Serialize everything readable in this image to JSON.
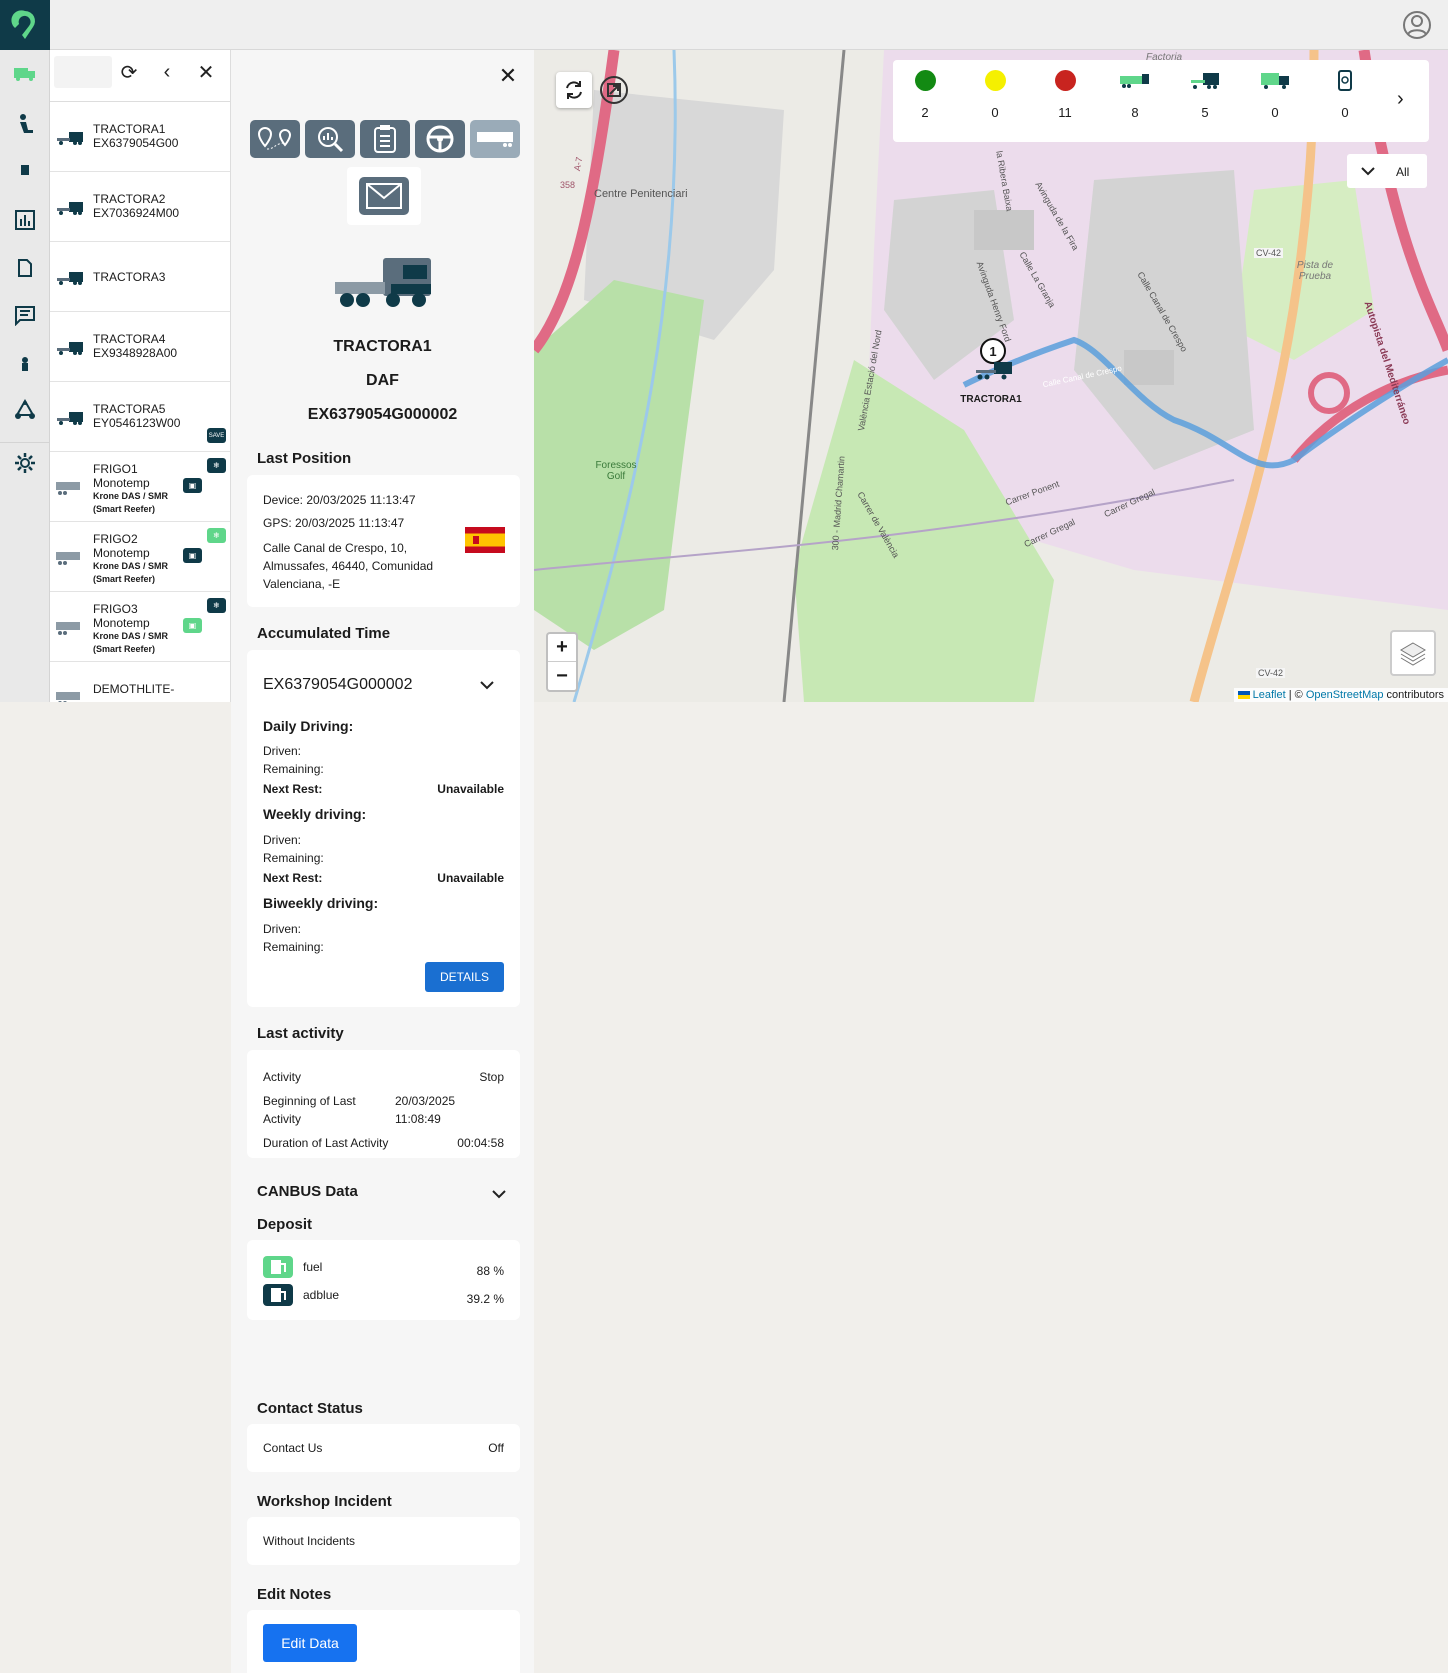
{
  "vehicle_list": {
    "items": [
      {
        "name": "TRACTORA1",
        "sub1": "EX6379054G00",
        "sub2": "",
        "sub3": ""
      },
      {
        "name": "TRACTORA2",
        "sub1": "EX7036924M00",
        "sub2": "",
        "sub3": ""
      },
      {
        "name": "TRACTORA3",
        "sub1": "",
        "sub2": "",
        "sub3": ""
      },
      {
        "name": "TRACTORA4",
        "sub1": "EX9348928A00",
        "sub2": "",
        "sub3": ""
      },
      {
        "name": "TRACTORA5",
        "sub1": "EY0546123W00",
        "sub2": "",
        "sub3": ""
      },
      {
        "name": "FRIGO1",
        "sub1": "Monotemp",
        "sub2": "Krone DAS / SMR",
        "sub3": "(Smart Reefer)"
      },
      {
        "name": "FRIGO2",
        "sub1": "Monotemp",
        "sub2": "Krone DAS / SMR",
        "sub3": "(Smart Reefer)"
      },
      {
        "name": "FRIGO3",
        "sub1": "Monotemp",
        "sub2": "Krone DAS / SMR",
        "sub3": "(Smart Reefer)"
      },
      {
        "name": "DEMOTHLITE-",
        "sub1": "",
        "sub2": "",
        "sub3": ""
      }
    ],
    "badge_text": "SAVE"
  },
  "detail": {
    "vehicle_name": "TRACTORA1",
    "brand": "DAF",
    "plate": "EX6379054G000002",
    "last_position": {
      "title": "Last Position",
      "device": "Device: 20/03/2025 11:13:47",
      "gps": "GPS: 20/03/2025 11:13:47",
      "address_lines": [
        "Calle Canal de Crespo, 10,",
        "Almussafes, 46440, Comunidad",
        "Valenciana, -E"
      ]
    },
    "accumulated": {
      "title": "Accumulated Time",
      "select_value": "EX6379054G000002",
      "daily_title": "Daily Driving:",
      "weekly_title": "Weekly driving:",
      "biweekly_title": "Biweekly driving:",
      "driven": "Driven:",
      "remaining": "Remaining:",
      "next_rest": "Next Rest:",
      "unavailable": "Unavailable",
      "details_button": "DETAILS"
    },
    "last_activity": {
      "title": "Last activity",
      "activity_label": "Activity",
      "activity_value": "Stop",
      "beginning_label_1": "Beginning of Last",
      "beginning_label_2": "Activity",
      "beginning_date": "20/03/2025",
      "beginning_time": "11:08:49",
      "duration_label": "Duration of Last Activity",
      "duration_value": "00:04:58"
    },
    "canbus": {
      "title": "CANBUS Data",
      "deposit_title": "Deposit",
      "fuel_label": "fuel",
      "fuel_value": "88 %",
      "adblue_label": "adblue",
      "adblue_value": "39.2 %"
    },
    "contact": {
      "title": "Contact Status",
      "label": "Contact Us",
      "value": "Off"
    },
    "workshop": {
      "title": "Workshop Incident",
      "value": "Without Incidents"
    },
    "notes": {
      "title": "Edit Notes",
      "button": "Edit Data"
    }
  },
  "map": {
    "legend_counts": [
      "2",
      "0",
      "11",
      "8",
      "5",
      "0",
      "0"
    ],
    "legend_colors": [
      "#138a13",
      "#f5f000",
      "#c8241f"
    ],
    "filter_label": "All",
    "marker_label": "TRACTORA1",
    "marker_number": "1",
    "attribution": {
      "leaflet": "Leaflet",
      "sep": " | © ",
      "osm": "OpenStreetMap",
      "contrib": " contributors"
    },
    "labels": {
      "penitenciari": "Centre Penitenciari",
      "golf": "Foressos Golf",
      "pista": "Pista de Prueba",
      "cv42": "CV-42",
      "a7": "A-7",
      "r358": "358",
      "autopista": "Autopista del Mediterráneo",
      "ponent": "Carrer Ponent",
      "gregal": "Carrer Gregal",
      "crespo": "Calle Canal de Crespo",
      "fora": "Avinguda de la Fira",
      "granja": "Calle La Granja",
      "henry": "Avinguda Henry Ford",
      "valencia": "Carrer de València",
      "ribera": "la Ribera Baixa",
      "factoria": "Factoria",
      "estacio": "València Estació del Nord",
      "madrid": "300 - Madrid Chamartin"
    }
  }
}
